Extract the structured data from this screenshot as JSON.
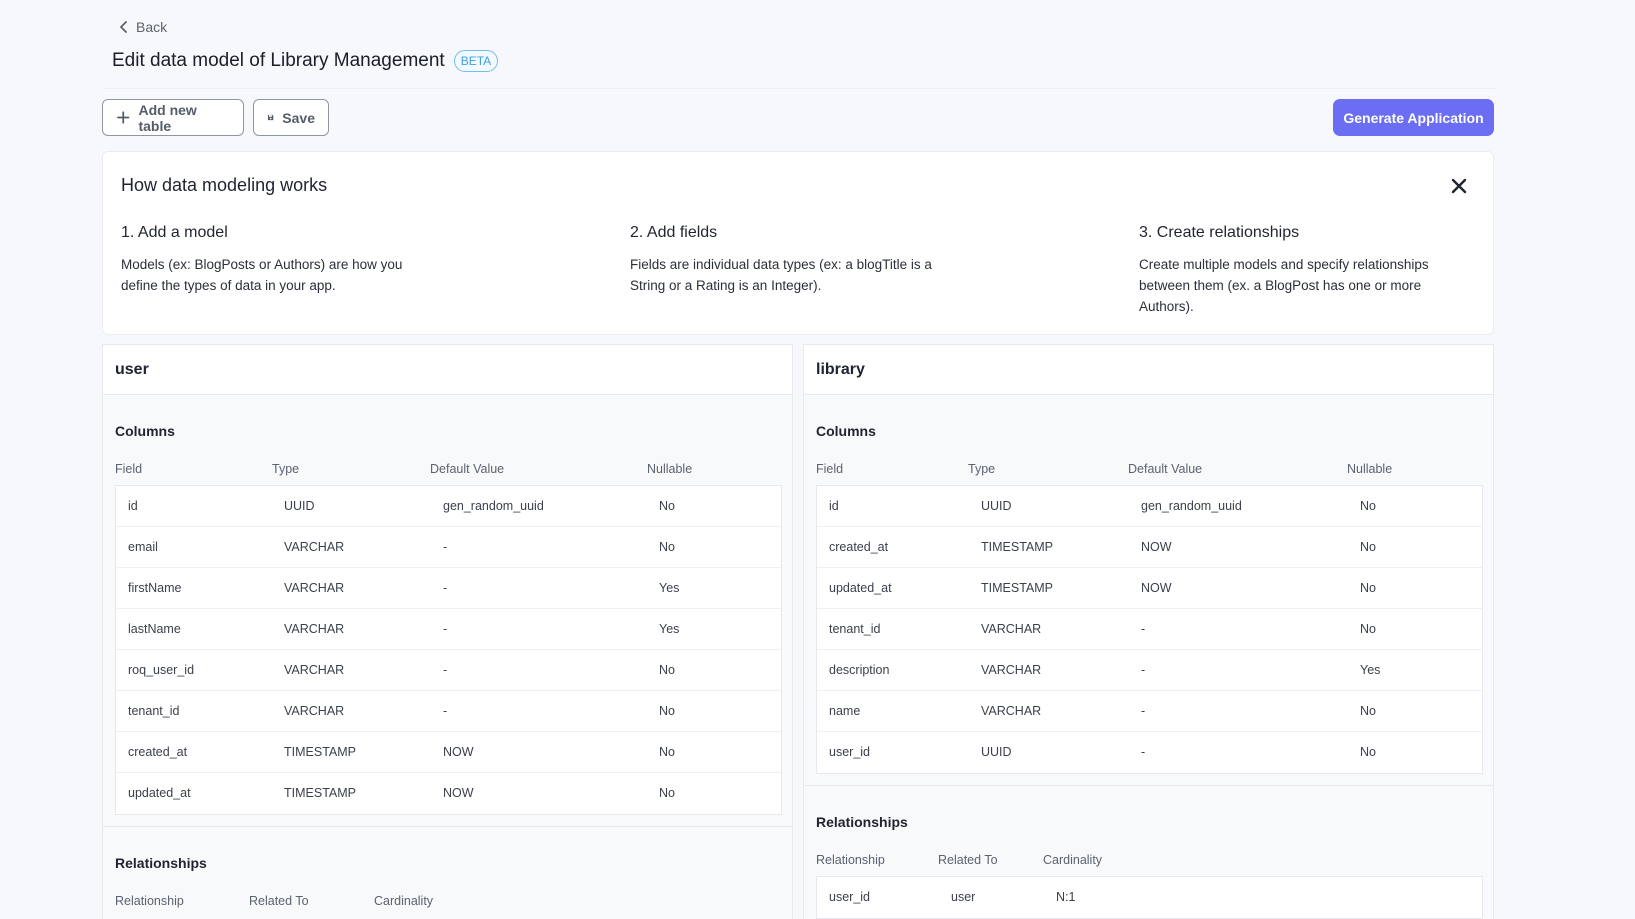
{
  "nav": {
    "back_label": "Back"
  },
  "header": {
    "title": "Edit data model of Library Management",
    "badge": "BETA"
  },
  "toolbar": {
    "add_table_label": "Add new table",
    "save_label": "Save",
    "generate_label": "Generate Application"
  },
  "howto": {
    "title": "How data modeling works",
    "steps": [
      {
        "title": "1. Add a model",
        "text": "Models (ex: BlogPosts or Authors) are how you define the types of data in your app."
      },
      {
        "title": "2. Add fields",
        "text": "Fields are individual data types (ex: a blogTitle is a String or a Rating is an Integer)."
      },
      {
        "title": "3. Create relationships",
        "text": "Create multiple models and specify relationships between them (ex. a BlogPost has one or more Authors)."
      }
    ]
  },
  "tables": [
    {
      "name": "user",
      "columns_title": "Columns",
      "column_headers": [
        "Field",
        "Type",
        "Default Value",
        "Nullable"
      ],
      "columns": [
        [
          "id",
          "UUID",
          "gen_random_uuid",
          "No"
        ],
        [
          "email",
          "VARCHAR",
          "-",
          "No"
        ],
        [
          "firstName",
          "VARCHAR",
          "-",
          "Yes"
        ],
        [
          "lastName",
          "VARCHAR",
          "-",
          "Yes"
        ],
        [
          "roq_user_id",
          "VARCHAR",
          "-",
          "No"
        ],
        [
          "tenant_id",
          "VARCHAR",
          "-",
          "No"
        ],
        [
          "created_at",
          "TIMESTAMP",
          "NOW",
          "No"
        ],
        [
          "updated_at",
          "TIMESTAMP",
          "NOW",
          "No"
        ]
      ],
      "relationships_title": "Relationships",
      "relationship_headers": [
        "Relationship",
        "Related To",
        "Cardinality"
      ],
      "relationships": []
    },
    {
      "name": "library",
      "columns_title": "Columns",
      "column_headers": [
        "Field",
        "Type",
        "Default Value",
        "Nullable"
      ],
      "columns": [
        [
          "id",
          "UUID",
          "gen_random_uuid",
          "No"
        ],
        [
          "created_at",
          "TIMESTAMP",
          "NOW",
          "No"
        ],
        [
          "updated_at",
          "TIMESTAMP",
          "NOW",
          "No"
        ],
        [
          "tenant_id",
          "VARCHAR",
          "-",
          "No"
        ],
        [
          "description",
          "VARCHAR",
          "-",
          "Yes"
        ],
        [
          "name",
          "VARCHAR",
          "-",
          "No"
        ],
        [
          "user_id",
          "UUID",
          "-",
          "No"
        ]
      ],
      "relationships_title": "Relationships",
      "relationship_headers": [
        "Relationship",
        "Related To",
        "Cardinality"
      ],
      "relationships": [
        [
          "user_id",
          "user",
          "N:1"
        ]
      ]
    }
  ]
}
